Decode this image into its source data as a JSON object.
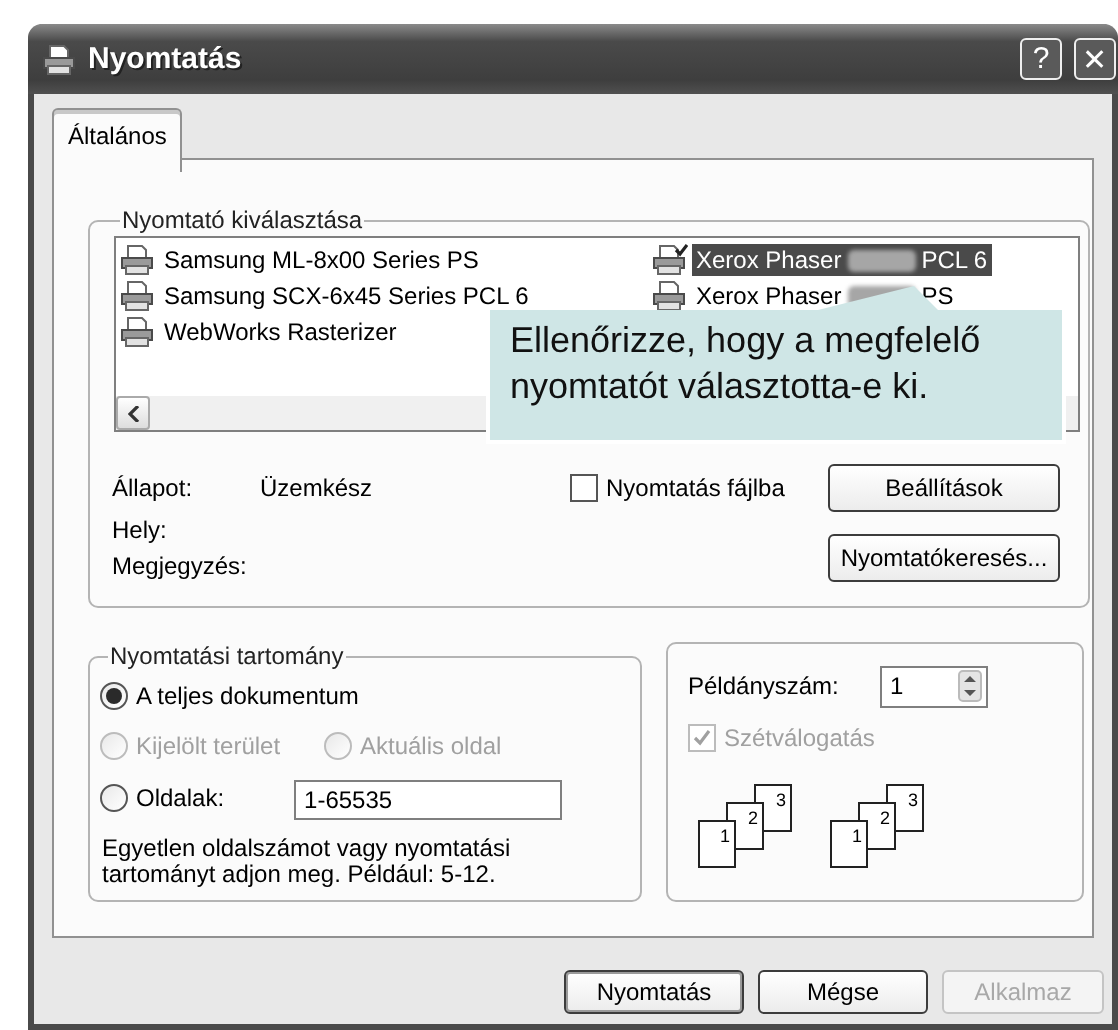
{
  "window": {
    "title": "Nyomtatás",
    "controls": [
      "?",
      "✕"
    ]
  },
  "tabs": [
    {
      "label": "Általános",
      "selected": true
    }
  ],
  "printer_selection": {
    "title": "Nyomtató kiválasztása",
    "printers": [
      {
        "name": "Samsung ML-8x00 Series PS",
        "selected": false,
        "default": false,
        "redacted": false
      },
      {
        "name": "Samsung SCX-6x45 Series PCL 6",
        "selected": false,
        "default": false,
        "redacted": false
      },
      {
        "name": "WebWorks Rasterizer",
        "selected": false,
        "default": false,
        "redacted": false
      },
      {
        "name": "Xerox Phaser",
        "model": "PCL 6",
        "selected": true,
        "default": true,
        "redacted": true
      },
      {
        "name": "Xerox Phaser",
        "model": "PS",
        "selected": false,
        "default": false,
        "redacted": true
      }
    ],
    "status_label": "Állapot:",
    "status": "Üzemkész",
    "location_label": "Hely:",
    "comment_label": "Megjegyzés:",
    "print_to_file": {
      "label": "Nyomtatás fájlba",
      "checked": false
    },
    "buttons": [
      "Beállítások",
      "Nyomtatókeresés..."
    ]
  },
  "callout": {
    "text": "Ellenőrizze, hogy a megfelelő nyomtatót választotta-e ki."
  },
  "print_range": {
    "title": "Nyomtatási tartomány",
    "options": [
      {
        "label": "A teljes dokumentum",
        "selected": true,
        "disabled": false
      },
      {
        "label": "Kijelölt terület",
        "selected": false,
        "disabled": true
      },
      {
        "label": "Aktuális oldal",
        "selected": false,
        "disabled": true
      },
      {
        "label": "Oldalak:",
        "selected": false,
        "disabled": false
      }
    ],
    "pages_value": "1-65535",
    "hint": "Egyetlen oldalszámot vagy nyomtatási tartományt adjon meg. Például: 5-12."
  },
  "copies": {
    "label": "Példányszám:",
    "value": "1",
    "collate": {
      "label": "Szétválogatás",
      "checked": true,
      "disabled": true
    },
    "collate_stacks": [
      [
        "1",
        "2",
        "3"
      ],
      [
        "1",
        "2",
        "3"
      ]
    ]
  },
  "dialog_buttons": [
    {
      "label": "Nyomtatás",
      "default": true,
      "disabled": false
    },
    {
      "label": "Mégse",
      "default": false,
      "disabled": false
    },
    {
      "label": "Alkalmaz",
      "default": false,
      "disabled": true
    }
  ]
}
